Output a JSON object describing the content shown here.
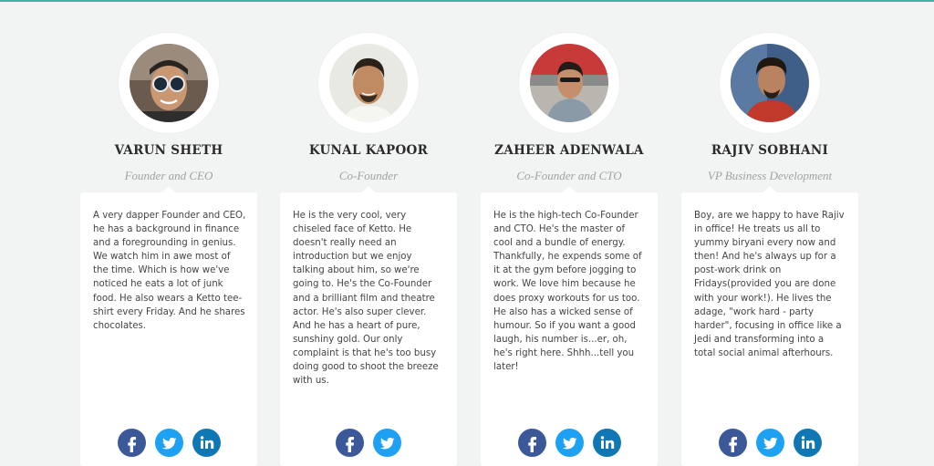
{
  "accent_color": "#3cb4a6",
  "team": [
    {
      "name": "VARUN SHETH",
      "role": "Founder and CEO",
      "bio": "A very dapper Founder and CEO, he has a background in finance and a foregrounding in genius. We watch him in awe most of the time. Which is how we've noticed he eats a lot of junk food. He also wears a Ketto tee-shirt every Friday. And he shares chocolates.",
      "socials": [
        "facebook-icon",
        "twitter-icon",
        "linkedin-icon"
      ]
    },
    {
      "name": "KUNAL KAPOOR",
      "role": "Co-Founder",
      "bio": "He is the very cool, very chiseled face of Ketto. He doesn't really need an introduction but we enjoy talking about him, so we're going to. He's the Co-Founder and a brilliant film and theatre actor. He's also super clever. And he has a heart of pure, sunshiny gold. Our only complaint is that he's too busy doing good to shoot the breeze with us.",
      "socials": [
        "facebook-icon",
        "twitter-icon"
      ]
    },
    {
      "name": "ZAHEER ADENWALA",
      "role": "Co-Founder and CTO",
      "bio": "He is the high-tech Co-Founder and CTO. He's the master of cool and a bundle of energy. Thankfully, he expends some of it at the gym before jogging to work. We love him because he does proxy workouts for us too. He also has a wicked sense of humour. So if you want a good laugh, his number is...er, oh, he's right here. Shhh...tell you later!",
      "socials": [
        "facebook-icon",
        "twitter-icon",
        "linkedin-icon"
      ]
    },
    {
      "name": "RAJIV SOBHANI",
      "role": "VP Business Development",
      "bio": "Boy, are we happy to have Rajiv in office! He treats us all to yummy biryani every now and then! And he's always up for a post-work drink on Fridays(provided you are done with your work!). He lives the adage, \"work hard - party harder\", focusing in office like a Jedi and transforming into a total social animal afterhours.",
      "socials": [
        "facebook-icon",
        "twitter-icon",
        "linkedin-icon"
      ]
    }
  ]
}
